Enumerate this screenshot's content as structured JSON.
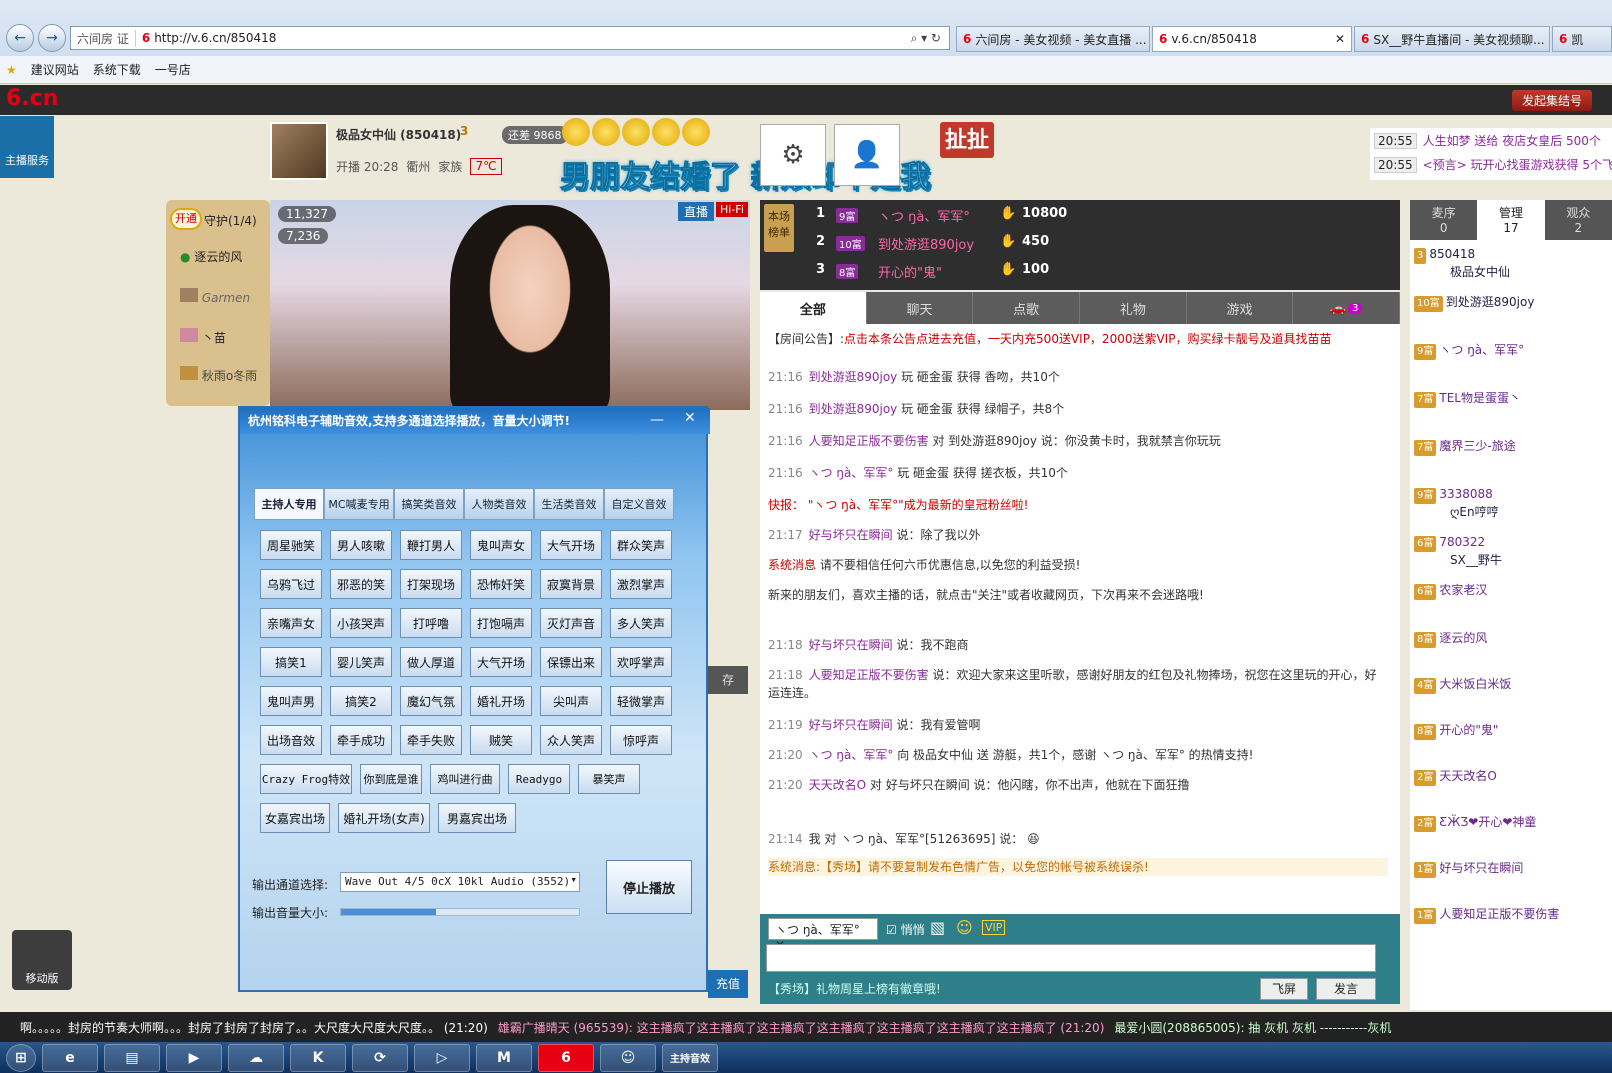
{
  "browser": {
    "address": "http://v.6.cn/850418",
    "addr_prefix": "六间房 证",
    "tabs": [
      "六间房 - 美女视频 - 美女直播 ...",
      "v.6.cn/850418",
      "SX__野牛直播间 - 美女视频聊...",
      "凯"
    ],
    "favorites": [
      "建议网站",
      "系统下载",
      "一号店"
    ]
  },
  "site": {
    "logo": "6.cn",
    "logo_small": "六间房",
    "jihe": "发起集结号",
    "anchor_service": "主播服务",
    "anchor_name": "极品女中仙 (850418)",
    "anchor_level": "3",
    "anchor_start": "开播 20:28",
    "anchor_loc": "衢州",
    "anchor_family": "家族",
    "anchor_temp": "7℃",
    "remain": "还差 9868",
    "slogan": "男朋友结婚了  新娘却不是我",
    "che_badge": "扯扯",
    "mobile": "移动版"
  },
  "ticker_top": [
    {
      "time": "20:55",
      "text": "人生如梦  送给 夜店女皇后 500个"
    },
    {
      "time": "20:55",
      "text": "<预言> 玩开心找蛋游戏获得 5个飞机"
    }
  ],
  "guard": {
    "open": "开通",
    "title": "守护(1/4)",
    "items": [
      "逐云的风",
      "Garmen",
      "丶苗",
      "秋雨o冬雨"
    ]
  },
  "video": {
    "wealth": "11,327",
    "fans": "7,236",
    "live": "直播",
    "hifi": "Hi-Fi",
    "save": "存",
    "recharge": "充值"
  },
  "dialog": {
    "title": "杭州铭科电子辅助音效,支持多通道选择播放，音量大小调节!",
    "tabs": [
      "主持人专用",
      "MC喊麦专用",
      "搞笑类音效",
      "人物类音效",
      "生活类音效",
      "自定义音效"
    ],
    "buttons": [
      [
        "周星驰笑",
        "男人咳嗽",
        "鞭打男人",
        "鬼叫声女",
        "大气开场",
        "群众笑声"
      ],
      [
        "乌鸦飞过",
        "邪恶的笑",
        "打架现场",
        "恐怖奸笑",
        "寂寞背景",
        "激烈掌声"
      ],
      [
        "亲嘴声女",
        "小孩哭声",
        "打呼噜",
        "打饱嗝声",
        "灭灯声音",
        "多人笑声"
      ],
      [
        "搞笑1",
        "婴儿笑声",
        "做人厚道",
        "大气开场",
        "保镖出来",
        "欢呼掌声"
      ],
      [
        "鬼叫声男",
        "搞笑2",
        "魔幻气氛",
        "婚礼开场",
        "尖叫声",
        "轻微掌声"
      ],
      [
        "出场音效",
        "牵手成功",
        "牵手失败",
        "贼笑",
        "众人笑声",
        "惊呼声"
      ]
    ],
    "row7": [
      "Crazy Frog特效",
      "你到底是谁",
      "鸡叫进行曲",
      "Readygo",
      "暴笑声"
    ],
    "row8": [
      "女嘉宾出场",
      "婚礼开场(女声)",
      "男嘉宾出场"
    ],
    "channel_label": "输出通道选择:",
    "channel_value": "Wave Out 4/5 0cX 10kl Audio (3552) -",
    "volume_label": "输出音量大小:",
    "volume": 0.4,
    "stop": "停止播放"
  },
  "rank": {
    "label": "本场榜单",
    "rows": [
      {
        "pos": "1",
        "level": "9富",
        "name": "ヽつ ŋà、军军°",
        "value": "10800"
      },
      {
        "pos": "2",
        "level": "10富",
        "name": "到处游逛890joy",
        "value": "450"
      },
      {
        "pos": "3",
        "level": "8富",
        "name": "开心的\"鬼\"",
        "value": "100"
      }
    ]
  },
  "chat_tabs": [
    "全部",
    "聊天",
    "点歌",
    "礼物",
    "游戏",
    "3"
  ],
  "notice_label": "【房间公告】:",
  "notice": "点击本条公告点进去充值，一天内充500送VIP，2000送紫VIP，购买绿卡靓号及道具找苗苗",
  "messages": [
    {
      "time": "21:16",
      "user": "到处游逛890joy",
      "text": "玩 砸金蛋 获得 香吻，共10个"
    },
    {
      "time": "21:16",
      "user": "到处游逛890joy",
      "text": "玩 砸金蛋 获得 绿帽子，共8个"
    },
    {
      "time": "21:16",
      "user": "人要知足正版不要伤害",
      "text": "对 到处游逛890joy 说：你没黄卡时，我就禁言你玩玩"
    },
    {
      "time": "21:16",
      "user": "ヽつ ŋà、军军°",
      "text": "玩 砸金蛋 获得 搓衣板，共10个"
    },
    {
      "time": "",
      "user": "快报：",
      "text": "\"ヽつ ŋà、军军°\"成为最新的皇冠粉丝啦!"
    },
    {
      "time": "21:17",
      "user": "好与坏只在瞬间",
      "text": "说：除了我以外"
    },
    {
      "time": "",
      "user": "系统消息",
      "text": "请不要相信任何六币优惠信息,以免您的利益受损!"
    },
    {
      "time": "",
      "user": "",
      "text": "新来的朋友们，喜欢主播的话，就点击\"关注\"或者收藏网页，下次再来不会迷路哦!"
    },
    {
      "time": "21:18",
      "user": "好与坏只在瞬间",
      "text": "说：我不跑商"
    },
    {
      "time": "21:18",
      "user": "人要知足正版不要伤害",
      "text": "说：欢迎大家来这里听歌，感谢好朋友的红包及礼物捧场，祝您在这里玩的开心，好运连连。"
    },
    {
      "time": "21:19",
      "user": "好与坏只在瞬间",
      "text": "说：我有爱管啊"
    },
    {
      "time": "21:20",
      "user": "ヽつ ŋà、军军°",
      "text": "向 极品女中仙 送 游艇，共1个，感谢 ヽつ ŋà、军军° 的热情支持!"
    },
    {
      "time": "21:20",
      "user": "天天改名O",
      "text": "对 好与坏只在瞬间 说：他闪瞎，你不出声，他就在下面狂撸"
    }
  ],
  "private": {
    "time": "21:14",
    "text": "我 对 ヽつ ŋà、军军°[51263695] 说："
  },
  "sysmsg": "系统消息:【秀场】请不要复制发布色情广告，以免您的帐号被系统误杀!",
  "input": {
    "target": "ヽつ ŋà、军军°",
    "whisper": "悄悄",
    "hint": "【秀场】礼物周星上榜有徽章哦!",
    "flyscreen": "飞屏",
    "send": "发言"
  },
  "right_tabs": [
    {
      "label": "麦序",
      "count": "0"
    },
    {
      "label": "管理",
      "count": "17"
    },
    {
      "label": "观众",
      "count": "2"
    }
  ],
  "users": [
    {
      "level": "3",
      "name": "850418",
      "sub": "极品女中仙"
    },
    {
      "level": "10富",
      "name": "到处游逛890joy",
      "sub": ""
    },
    {
      "level": "9富",
      "name": "ヽつ ŋà、军军°",
      "sub": ""
    },
    {
      "level": "7富",
      "name": "TEL物是蛋蛋丶",
      "sub": ""
    },
    {
      "level": "7富",
      "name": "魔界三少-旅途",
      "sub": ""
    },
    {
      "level": "9富",
      "name": "3338088",
      "sub": "ღEn哼哼"
    },
    {
      "level": "6富",
      "name": "780322",
      "sub": "SX__野牛"
    },
    {
      "level": "6富",
      "name": "农家老汉",
      "sub": ""
    },
    {
      "level": "8富",
      "name": "逐云的风",
      "sub": ""
    },
    {
      "level": "4富",
      "name": "大米饭白米饭",
      "sub": ""
    },
    {
      "level": "8富",
      "name": "开心的\"鬼\"",
      "sub": ""
    },
    {
      "level": "2富",
      "name": "天天改名O",
      "sub": ""
    },
    {
      "level": "2富",
      "name": "ƸӜƷ❤开心❤神童",
      "sub": ""
    },
    {
      "level": "1富",
      "name": "好与坏只在瞬间",
      "sub": ""
    },
    {
      "level": "1富",
      "name": "人要知足正版不要伤害",
      "sub": ""
    }
  ],
  "marquee": [
    "啊。。。。。封房的节奏大师啊。。。封房了封房了封房了。。大尺度大尺度大尺度。。 (21:20)",
    "雄霸广播晴天 (965539): 这主播疯了这主播疯了这主播疯了这主播疯了这主播疯了这主播疯了这主播疯了 (21:20)",
    "最爱小圆(208865005): 抽 灰机 灰机 -----------灰机"
  ],
  "taskbar": [
    "e",
    "▤",
    "▶",
    "☁",
    "K",
    "⟳",
    "▷",
    "M",
    "6",
    "☺",
    "主持音效"
  ],
  "colors": {
    "accent": "#e60012",
    "chat_user": "#8a2b9a",
    "dialog": "#3a8cd6"
  }
}
